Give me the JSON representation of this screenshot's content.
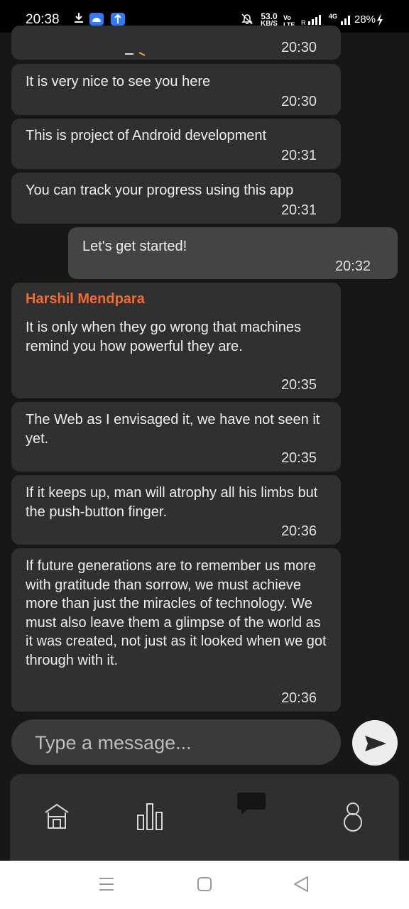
{
  "status_bar": {
    "time": "20:38",
    "net_speed": "53.0",
    "net_unit": "KB/S",
    "network_type": "4G",
    "battery": "28%"
  },
  "messages": [
    {
      "text": "",
      "time": "20:30"
    },
    {
      "text": "It is very nice to see you here",
      "time": "20:30"
    },
    {
      "text": "This is project of Android development",
      "time": "20:31"
    },
    {
      "text": "You can track your progress using this app",
      "time": "20:31"
    },
    {
      "text": "Let's get started!",
      "time": "20:32",
      "outgoing": true
    },
    {
      "sender": "Harshil Mendpara",
      "text": "It is only when they go wrong that machines remind you how powerful they are.",
      "time": "20:35"
    },
    {
      "text": "The Web as I envisaged it, we have not seen it yet.",
      "time": "20:35"
    },
    {
      "text": "If it keeps up, man will atrophy all his limbs but the push-button finger.",
      "time": "20:36"
    },
    {
      "text": "If future generations are to remember us more with gratitude than sorrow, we must achieve more than just the miracles of technology. We must also leave them a glimpse of the world as it was created, not just as it looked when we got through with it.",
      "time": "20:36"
    }
  ],
  "composer": {
    "placeholder": "Type a message..."
  },
  "bottom_nav": {
    "items": [
      {
        "icon": "home-icon"
      },
      {
        "icon": "bar-chart-icon"
      },
      {
        "icon": "chat-icon",
        "active": true
      },
      {
        "icon": "profile-icon"
      }
    ]
  },
  "system_nav": {
    "icons": [
      "recents-icon",
      "home-square-icon",
      "back-triangle-icon"
    ]
  },
  "colors": {
    "background": "#171717",
    "bubble": "#303030",
    "bubble_outgoing": "#444444",
    "sender_name": "#f26a32"
  }
}
